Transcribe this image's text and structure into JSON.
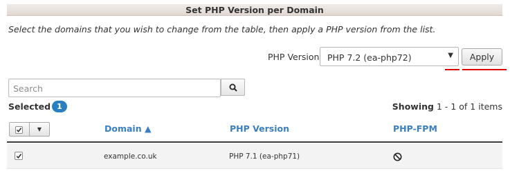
{
  "header": {
    "title": "Set PHP Version per Domain"
  },
  "instructions": "Select the domains that you wish to change from the table, then apply a PHP version from the list.",
  "php_version": {
    "label": "PHP Version",
    "selected": "PHP 7.2 (ea-php72)",
    "apply_label": "Apply"
  },
  "search": {
    "placeholder": "Search"
  },
  "selection": {
    "selected_label": "Selected",
    "selected_count": "1",
    "showing_label": "Showing",
    "showing_range": "1 - 1 of 1 items"
  },
  "table": {
    "columns": {
      "domain": "Domain ▲",
      "php_version": "PHP Version",
      "php_fpm": "PHP-FPM"
    },
    "rows": [
      {
        "domain": "example.co.uk",
        "php_version": "PHP 7.1 (ea-php71)",
        "php_fpm": "disabled-icon",
        "checked": true
      }
    ]
  },
  "colors": {
    "accent_link": "#3a7fc1",
    "badge": "#2980c1",
    "annotation_red": "#e00000"
  },
  "icons": [
    "search-icon",
    "chevron-down-icon",
    "checkbox-checked-icon",
    "disabled-icon"
  ]
}
